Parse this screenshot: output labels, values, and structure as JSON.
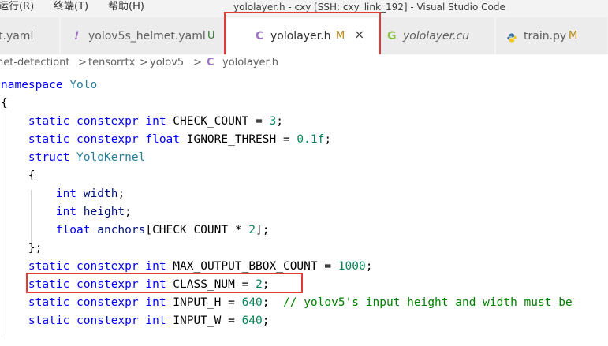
{
  "menu": {
    "items": [
      "运行(R)",
      "终端(T)",
      "帮助(H)"
    ]
  },
  "window": {
    "title": "yololayer.h - cxy [SSH: cxy_link_192] - Visual Studio Code"
  },
  "tabs": [
    {
      "label": "t.yaml",
      "status": "",
      "active": false
    },
    {
      "icon": "!",
      "label": "yolov5s_helmet.yaml",
      "status": "U",
      "active": false
    },
    {
      "icon": "C",
      "label": "yololayer.h",
      "status": "M",
      "close": "×",
      "active": true
    },
    {
      "icon": "G",
      "label": "yololayer.cu",
      "status": "",
      "active": false
    },
    {
      "icon": "py",
      "label": "train.py",
      "status": "M",
      "active": false
    }
  ],
  "breadcrumb": {
    "parts": [
      "net-detectiont",
      "tensorrtx",
      "yolov5",
      "yololayer.h"
    ],
    "separator": ">",
    "file_icon": "C"
  },
  "code": {
    "lines": [
      "namespace Yolo",
      "{",
      "    static constexpr int CHECK_COUNT = 3;",
      "    static constexpr float IGNORE_THRESH = 0.1f;",
      "    struct YoloKernel",
      "    {",
      "        int width;",
      "        int height;",
      "        float anchors[CHECK_COUNT * 2];",
      "    };",
      "    static constexpr int MAX_OUTPUT_BBOX_COUNT = 1000;",
      "    static constexpr int CLASS_NUM = 2;",
      "    static constexpr int INPUT_H = 640;  // yolov5's input height and width must be",
      "    static constexpr int INPUT_W = 640;"
    ]
  },
  "colors": {
    "keyword": "#0000ff",
    "type": "#267f99",
    "number": "#098658",
    "comment": "#008000",
    "highlight": "#e53935",
    "modified": "#b8860b",
    "untracked": "#2e7d32",
    "c_icon": "#a074c4",
    "yaml_icon": "#a074c4",
    "cu_icon": "#8dc149",
    "py_icon": "#3572a5"
  }
}
